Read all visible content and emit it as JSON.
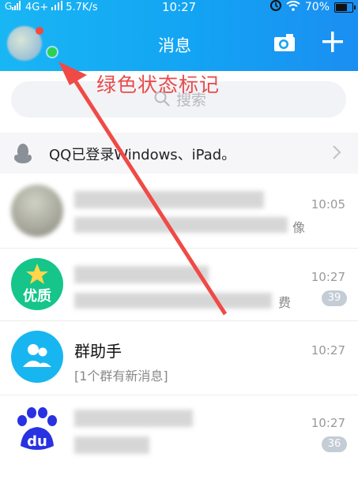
{
  "status_bar": {
    "carrier": "4G+",
    "speed": "5.7K/s",
    "time": "10:27",
    "battery_percent": "70%",
    "battery_level": 0.7
  },
  "header": {
    "title": "消息",
    "camera_icon": "camera-icon",
    "plus_icon": "plus-icon"
  },
  "annotation": {
    "label": "绿色状态标记"
  },
  "search": {
    "placeholder": "搜索"
  },
  "login_notice": {
    "text": "QQ已登录Windows、iPad。"
  },
  "conversations": [
    {
      "time": "10:05",
      "preview_tail": "像"
    },
    {
      "avatar_label": "优质",
      "time": "10:27",
      "preview_tail": "费",
      "unread": "39"
    },
    {
      "name": "群助手",
      "preview": "[1个群有新消息]",
      "time": "10:27"
    },
    {
      "avatar_label": "du",
      "time": "10:27",
      "unread": "36"
    }
  ],
  "colors": {
    "header_blue": "#13a3f3",
    "online_green": "#2dd14e",
    "annotation_red": "#e84b4b",
    "unread_badge": "#c4ccd6"
  }
}
